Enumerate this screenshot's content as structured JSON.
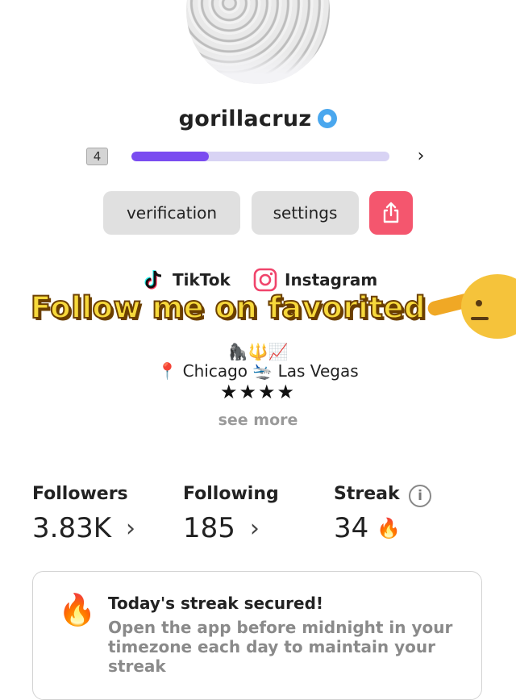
{
  "profile": {
    "username": "gorillacruz",
    "verified_icon": "verified-badge-icon",
    "accent_color": "#4aa7ee"
  },
  "level": {
    "number": "4",
    "progress": 0.3,
    "track_color": "#d8d3f4",
    "fill_color": "#7a4cf0",
    "chevron": "›"
  },
  "actions": {
    "verification_label": "verification",
    "settings_label": "settings",
    "share_icon": "share-icon",
    "share_color": "#f4566e"
  },
  "social": {
    "tiktok_label": "TikTok",
    "instagram_label": "Instagram"
  },
  "banner": {
    "text": "Follow me on favorited",
    "emoji": "saluting-face"
  },
  "bio": {
    "emojis": "🦍🔱📈",
    "city_line": "📍 Chicago 🛬 Las Vegas",
    "stars": "★★★★",
    "see_more": "see more"
  },
  "stats": {
    "followers_label": "Followers",
    "followers_value": "3.83K",
    "following_label": "Following",
    "following_value": "185",
    "streak_label": "Streak",
    "streak_value": "34",
    "streak_emoji": "🔥",
    "chevron": "›",
    "info": "i"
  },
  "streak_card": {
    "emoji": "🔥",
    "title": "Today's streak secured!",
    "body": "Open the app before midnight in your timezone each day to maintain your streak"
  }
}
